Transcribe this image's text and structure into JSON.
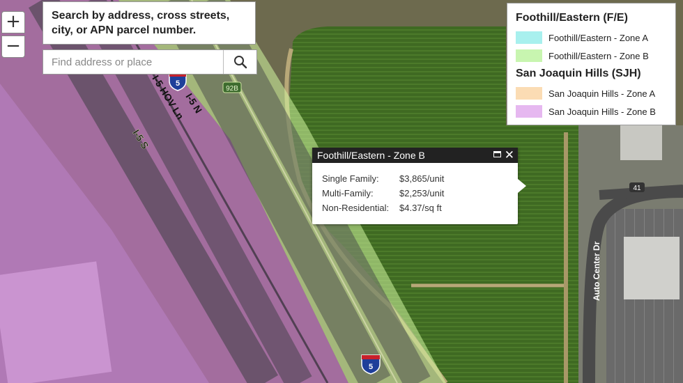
{
  "map": {
    "road_labels": {
      "i5_s": "I-5 S",
      "i5_hov": "I-5 HOV Ln",
      "i5_n": "I-5 N",
      "exit_92b": "92B",
      "route_41": "41",
      "auto_center_dr": "Auto Center Dr"
    },
    "shield_number": "5",
    "zone_colors": {
      "fe_zone_a": "#a8f0ee",
      "fe_zone_b": "#c8f5b0",
      "sjh_zone_a": "#fbdcb4",
      "sjh_zone_b": "#e6b8f0",
      "overlay_fe_b": "#d2f5a0",
      "overlay_sjh_b": "#d070e0"
    }
  },
  "controls": {
    "zoom_in": "+",
    "zoom_out": "−"
  },
  "search": {
    "hint": "Search by address, cross streets, city, or APN parcel number.",
    "placeholder": "Find address or place",
    "button_icon": "search-icon"
  },
  "legend": {
    "groups": [
      {
        "title": "Foothill/Eastern (F/E)",
        "items": [
          {
            "label": "Foothill/Eastern - Zone A",
            "color": "#a8f0ee"
          },
          {
            "label": "Foothill/Eastern - Zone B",
            "color": "#c8f5b0"
          }
        ]
      },
      {
        "title": "San Joaquin Hills (SJH)",
        "items": [
          {
            "label": "San Joaquin Hills - Zone A",
            "color": "#fbdcb4"
          },
          {
            "label": "San Joaquin Hills - Zone B",
            "color": "#e6b8f0"
          }
        ]
      }
    ]
  },
  "popup": {
    "title": "Foothill/Eastern - Zone B",
    "rows": [
      {
        "label": "Single Family:",
        "value": "$3,865/unit"
      },
      {
        "label": "Multi-Family:",
        "value": "$2,253/unit"
      },
      {
        "label": "Non-Residential:",
        "value": "$4.37/sq ft"
      }
    ],
    "maximize_icon": "maximize-icon",
    "close_icon": "close-icon"
  }
}
